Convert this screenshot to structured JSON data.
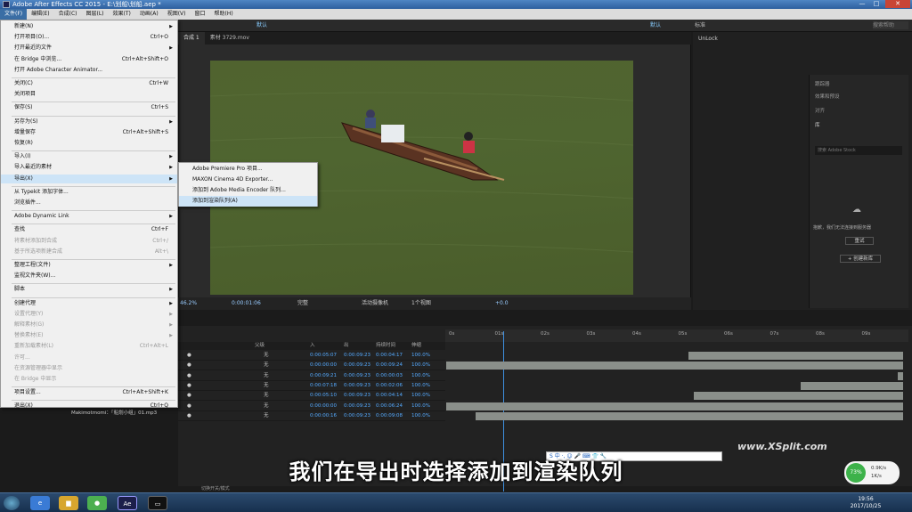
{
  "window": {
    "title": "Adobe After Effects CC 2015 - E:\\划船\\划船.aep *",
    "minimize": "—",
    "maximize": "□",
    "close": "✕"
  },
  "menubar": [
    "文件(F)",
    "编辑(E)",
    "合成(C)",
    "图层(L)",
    "效果(T)",
    "动画(A)",
    "视图(V)",
    "窗口",
    "帮助(H)"
  ],
  "toolbar": {
    "workspace": "默认",
    "standard": "标准",
    "search": "搜索帮助"
  },
  "comp_tabs": [
    "合成 1",
    "素材 3729.mov"
  ],
  "right_panel": {
    "title": "UnLock",
    "sections": [
      "跟踪器",
      "效果和预设",
      "对齐",
      "库"
    ],
    "lib_search": "搜索 Adobe Stock",
    "sync_msg": "抱歉，我们无法连接到服务器",
    "retry": "重试",
    "create_lib": "+ 创建新库"
  },
  "comp_status": {
    "zoom": "46.2%",
    "time": "0:00:01:06",
    "quality": "完整",
    "camera": "活动摄像机",
    "views": "1个视图",
    "offset": "+0.0"
  },
  "timeline_header": [
    "父级",
    "入",
    "出",
    "持续时间",
    "伸缩"
  ],
  "timeline_rows": [
    {
      "parent": "无",
      "in": "0:00:05:07",
      "out": "0:00:09:23",
      "dur": "0:00:04:17",
      "stretch": "100.0%"
    },
    {
      "parent": "无",
      "in": "0:00:00:00",
      "out": "0:00:09:23",
      "dur": "0:00:09:24",
      "stretch": "100.0%"
    },
    {
      "parent": "无",
      "in": "0:00:09:21",
      "out": "0:00:09:23",
      "dur": "0:00:00:03",
      "stretch": "100.0%"
    },
    {
      "parent": "无",
      "in": "0:00:07:18",
      "out": "0:00:09:23",
      "dur": "0:00:02:06",
      "stretch": "100.0%"
    },
    {
      "parent": "无",
      "in": "0:00:05:10",
      "out": "0:00:09:23",
      "dur": "0:00:04:14",
      "stretch": "100.0%"
    },
    {
      "parent": "无",
      "in": "0:00:00:00",
      "out": "0:00:09:23",
      "dur": "0:00:06:24",
      "stretch": "100.0%"
    },
    {
      "parent": "无",
      "in": "0:00:00:16",
      "out": "0:00:09:23",
      "dur": "0:00:09:08",
      "stretch": "100.0%"
    }
  ],
  "ruler_ticks": [
    "0s",
    "01s",
    "02s",
    "03s",
    "04s",
    "05s",
    "06s",
    "07s",
    "08s",
    "09s"
  ],
  "layer_name": "Makimotmomi：「船划小组」01.mp3",
  "file_menu": [
    {
      "label": "新建(N)",
      "shortcut": "",
      "arrow": true
    },
    {
      "label": "打开项目(O)...",
      "shortcut": "Ctrl+O"
    },
    {
      "label": "打开最近的文件",
      "shortcut": "",
      "arrow": true
    },
    {
      "label": "在 Bridge 中浏览...",
      "shortcut": "Ctrl+Alt+Shift+O"
    },
    {
      "label": "打开 Adobe Character Animator...",
      "shortcut": ""
    },
    {
      "label": "关闭(C)",
      "shortcut": "Ctrl+W"
    },
    {
      "label": "关闭项目",
      "shortcut": ""
    },
    {
      "label": "保存(S)",
      "shortcut": "Ctrl+S"
    },
    {
      "label": "另存为(S)",
      "shortcut": "",
      "arrow": true
    },
    {
      "label": "增量保存",
      "shortcut": "Ctrl+Alt+Shift+S"
    },
    {
      "label": "恢复(R)",
      "shortcut": ""
    },
    {
      "label": "导入(I)",
      "shortcut": "",
      "arrow": true
    },
    {
      "label": "导入最近的素材",
      "shortcut": "",
      "arrow": true
    },
    {
      "label": "导出(X)",
      "shortcut": "",
      "arrow": true,
      "highlight": true
    },
    {
      "label": "从 Typekit 添加字体...",
      "shortcut": ""
    },
    {
      "label": "浏览插件...",
      "shortcut": ""
    },
    {
      "label": "Adobe Dynamic Link",
      "shortcut": "",
      "arrow": true
    },
    {
      "label": "查找",
      "shortcut": "Ctrl+F"
    },
    {
      "label": "将素材添加到合成",
      "shortcut": "Ctrl+/",
      "disabled": true
    },
    {
      "label": "基于所选项新建合成",
      "shortcut": "Alt+\\",
      "disabled": true
    },
    {
      "label": "整理工程(文件)",
      "shortcut": "",
      "arrow": true
    },
    {
      "label": "监视文件夹(W)...",
      "shortcut": ""
    },
    {
      "label": "脚本",
      "shortcut": "",
      "arrow": true
    },
    {
      "label": "创建代理",
      "shortcut": "",
      "arrow": true
    },
    {
      "label": "设置代理(Y)",
      "shortcut": "",
      "arrow": true,
      "disabled": true
    },
    {
      "label": "解释素材(G)",
      "shortcut": "",
      "arrow": true,
      "disabled": true
    },
    {
      "label": "替换素材(E)",
      "shortcut": "",
      "arrow": true,
      "disabled": true
    },
    {
      "label": "重新加载素材(L)",
      "shortcut": "Ctrl+Alt+L",
      "disabled": true
    },
    {
      "label": "许可...",
      "shortcut": "",
      "disabled": true
    },
    {
      "label": "在资源管理器中显示",
      "shortcut": "",
      "disabled": true
    },
    {
      "label": "在 Bridge 中显示",
      "shortcut": "",
      "disabled": true
    },
    {
      "label": "项目设置...",
      "shortcut": "Ctrl+Alt+Shift+K"
    },
    {
      "label": "退出(X)",
      "shortcut": "Ctrl+Q"
    }
  ],
  "export_submenu": [
    "Adobe Premiere Pro 项目...",
    "MAXON Cinema 4D Exporter...",
    "添加到 Adobe Media Encoder 队列...",
    "添加到渲染队列(A)"
  ],
  "subtitle": "我们在导出时选择添加到渲染队列",
  "watermark": "www.XSplit.com",
  "ime": "S 中 ·, ☺ 🎤 ⌨ 👕 🔧",
  "net": {
    "pct": "73%",
    "up": "0.9K/s",
    "down": "1K/s"
  },
  "clock": {
    "time": "19:56",
    "date": "2017/10/25"
  },
  "bottom_label": "切换开关/模式"
}
